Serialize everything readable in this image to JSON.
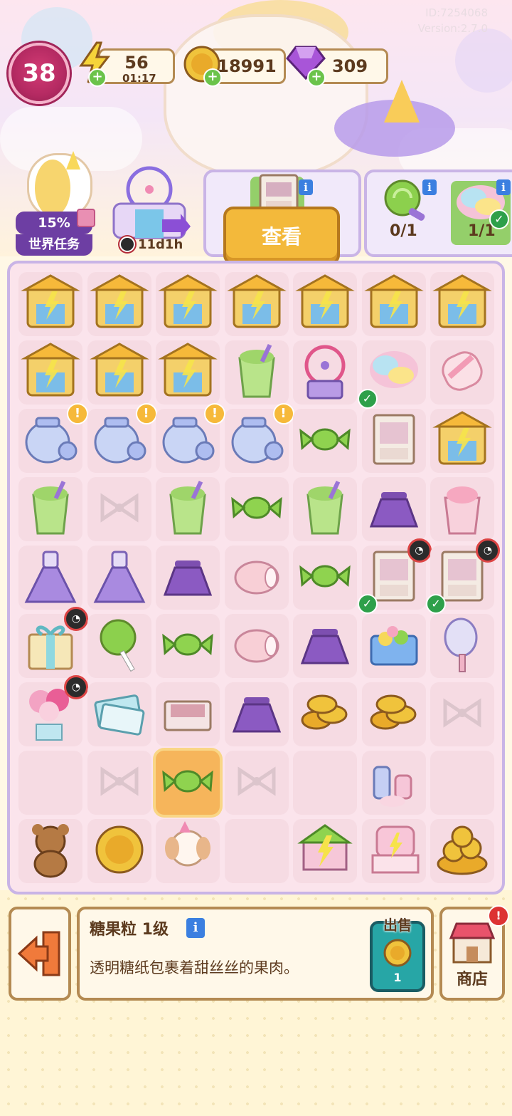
{
  "meta": {
    "id": "ID:7254068",
    "version": "Version:2.7.0"
  },
  "player": {
    "level": "38"
  },
  "resources": {
    "energy": {
      "value": "56",
      "timer": "01:17",
      "icon": "lightning-icon"
    },
    "coins": {
      "value": "18991",
      "icon": "coin-icon"
    },
    "gems": {
      "value": "309",
      "icon": "gem-icon"
    }
  },
  "quest": {
    "percent": "15%",
    "label": "世界任务"
  },
  "park": {
    "timer": "11d1h"
  },
  "orders": {
    "order1": {
      "item": "cabinet-icon"
    },
    "order2": {
      "slots": [
        {
          "item": "lollipop-icon",
          "count": "0/1",
          "done": false
        },
        {
          "item": "cotton-candy-icon",
          "count": "1/1",
          "done": true
        }
      ]
    },
    "view_button": "查看"
  },
  "board": {
    "columns": 7,
    "rows": 9,
    "cells": [
      [
        "carousel",
        "carousel",
        "carousel",
        "carousel",
        "carousel",
        "carousel",
        "carousel"
      ],
      [
        "carousel",
        "carousel",
        "carousel",
        "melon-drink",
        "ferris-wheel",
        "cotton-candy",
        "marshmallow"
      ],
      [
        "jar",
        "jar",
        "jar",
        "jar",
        "candy",
        "cabinet",
        "carousel"
      ],
      [
        "melon-drink",
        "bow",
        "melon-drink",
        "candy",
        "melon-drink",
        "skirt",
        "strawberry-drink"
      ],
      [
        "dress",
        "dress",
        "skirt",
        "cake-roll",
        "candy",
        "cabinet",
        "cabinet"
      ],
      [
        "gift-box",
        "lollipop",
        "candy",
        "cake-roll",
        "skirt",
        "candy-box",
        "mirror"
      ],
      [
        "balloons",
        "tickets",
        "drawer",
        "skirt",
        "coins",
        "coins",
        "bow"
      ],
      [
        "empty",
        "bow",
        "candy",
        "bow",
        "empty",
        "cosmetics",
        "empty"
      ],
      [
        "teddy-bear",
        "coin",
        "puppy",
        "empty",
        "shop-house",
        "vanity",
        "coin-pile"
      ]
    ],
    "selected": {
      "row": 7,
      "col": 2
    }
  },
  "selected_item": {
    "name": "糖果粒 1级",
    "description": "透明糖纸包裹着甜丝丝的果肉。",
    "sell_label": "出售",
    "sell_price": "1"
  },
  "shop": {
    "label": "商店"
  },
  "colors": {
    "board_bg": "#fbe4ec",
    "board_border": "#c9b4e6",
    "panel_border": "#b48a52",
    "accent_yellow": "#f3b93b",
    "level_pink": "#b42a62"
  }
}
